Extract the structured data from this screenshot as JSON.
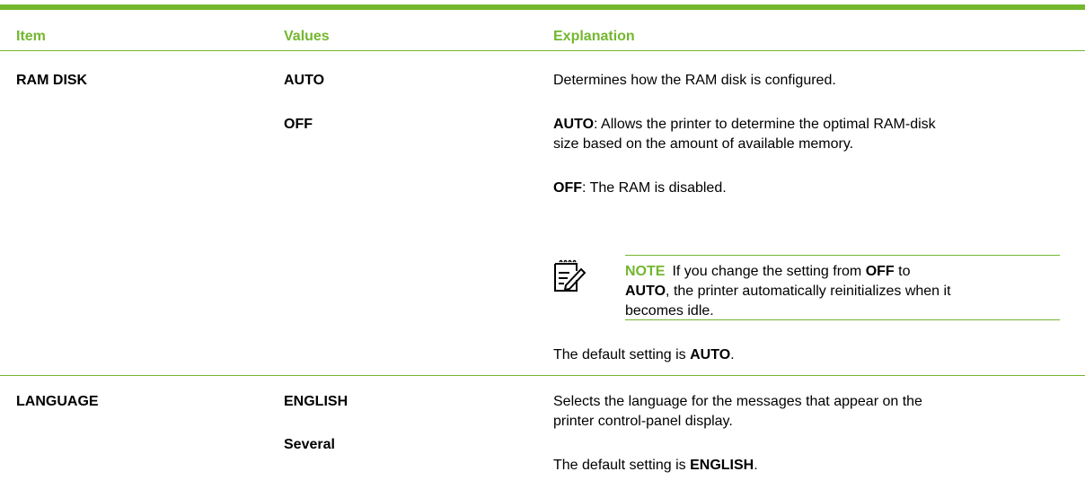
{
  "header": {
    "item": "Item",
    "values": "Values",
    "explanation": "Explanation"
  },
  "rows": [
    {
      "item": "RAM DISK",
      "values": [
        "AUTO",
        "OFF"
      ],
      "expl_intro": "Determines how the RAM disk is configured.",
      "auto_key": "AUTO",
      "auto_text": ": Allows the printer to determine the optimal RAM-disk",
      "auto_text2": "size based on the amount of available memory.",
      "off_key": "OFF",
      "off_text": ": The RAM is disabled.",
      "note": {
        "label": "NOTE",
        "text_a": "If you change the setting from",
        "bold_a": "OFF",
        "text_b": "to",
        "bold_b": "AUTO",
        "text_c": ", the printer automatically reinitializes when it",
        "text_d": "becomes idle."
      },
      "default_prefix": "The default setting is",
      "default_value": "AUTO",
      "default_suffix": "."
    },
    {
      "item": "LANGUAGE",
      "values": [
        "ENGLISH",
        "Several"
      ],
      "expl_line1": "Selects the language for the messages that appear on the",
      "expl_line2": "printer control-panel display.",
      "default_prefix": "The default setting is",
      "default_value": "ENGLISH",
      "default_suffix": "."
    }
  ],
  "colors": {
    "accent": "#73b72e"
  }
}
